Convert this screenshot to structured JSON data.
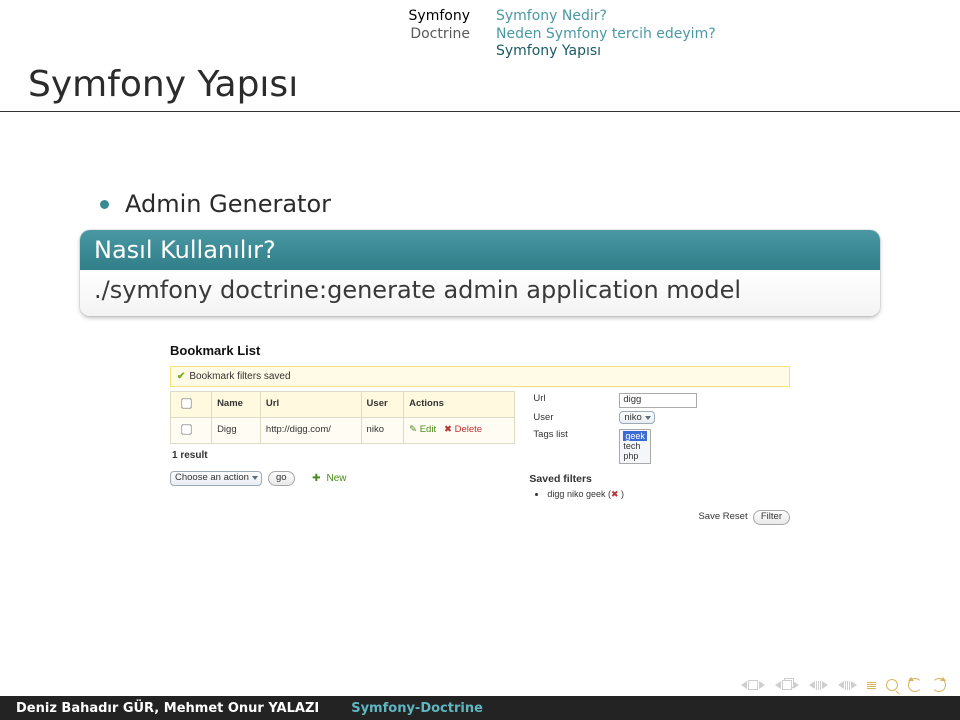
{
  "topnav": {
    "left": {
      "section": "Symfony",
      "inactive": "Doctrine"
    },
    "right": {
      "sub1": "Symfony Nedir?",
      "sub2": "Neden Symfony tercih edeyim?",
      "sub3_active": "Symfony Yapısı"
    }
  },
  "frametitle": "Symfony Yapısı",
  "bullet_item": "Admin Generator",
  "example": {
    "title": "Nasıl Kullanılır?",
    "body": "./symfony doctrine:generate admin application model"
  },
  "admin": {
    "heading": "Bookmark List",
    "flash": "Bookmark filters saved",
    "cols": {
      "name": "Name",
      "url": "Url",
      "user": "User",
      "actions": "Actions"
    },
    "row": {
      "name": "Digg",
      "url": "http://digg.com/",
      "user": "niko",
      "edit_icon": "✎",
      "edit": "Edit",
      "del_icon": "✖",
      "del": "Delete"
    },
    "result_count": "1 result",
    "batch": {
      "choose": "Choose an action",
      "go": "go",
      "new_icon": "✚",
      "new": "New"
    },
    "filter": {
      "url_label": "Url",
      "url_val": "digg",
      "user_label": "User",
      "user_val": "niko",
      "tags_label": "Tags list",
      "tag1": "geek",
      "tag2": "tech",
      "tag3": "php",
      "saved_heading": "Saved filters",
      "saved_item": "digg niko geek (",
      "saved_del": "✖",
      "saved_close": " )",
      "save": "Save",
      "reset": "Reset",
      "filter": "Filter"
    }
  },
  "footer": {
    "authors": "Deniz Bahadır GÜR, Mehmet Onur YALAZI",
    "title": "Symfony-Doctrine"
  }
}
